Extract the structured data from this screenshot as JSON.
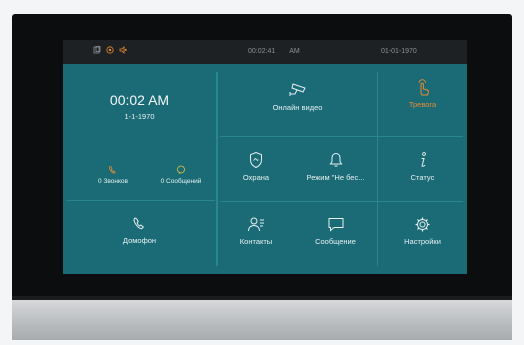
{
  "status_bar": {
    "icons": [
      "door-icon",
      "alarm-icon",
      "speaker-icon"
    ],
    "time": "00:02:41",
    "ampm": "AM",
    "date": "01-01-1970"
  },
  "clock": {
    "time": "00:02 AM",
    "date": "1-1-1970"
  },
  "stats": {
    "calls": "0 Звонков",
    "messages": "0 Сообщений"
  },
  "tiles": {
    "intercom": "Домофон",
    "online_video": "Онлайн видео",
    "alarm": "Тревога",
    "security": "Охрана",
    "mode": "Режим \"Не бес...",
    "status": "Статус",
    "contacts": "Контакты",
    "message": "Сообщение",
    "settings": "Настройки"
  },
  "colors": {
    "panel": "#1b6b76",
    "accent": "#e98a2f",
    "text": "#e6f1f2"
  }
}
